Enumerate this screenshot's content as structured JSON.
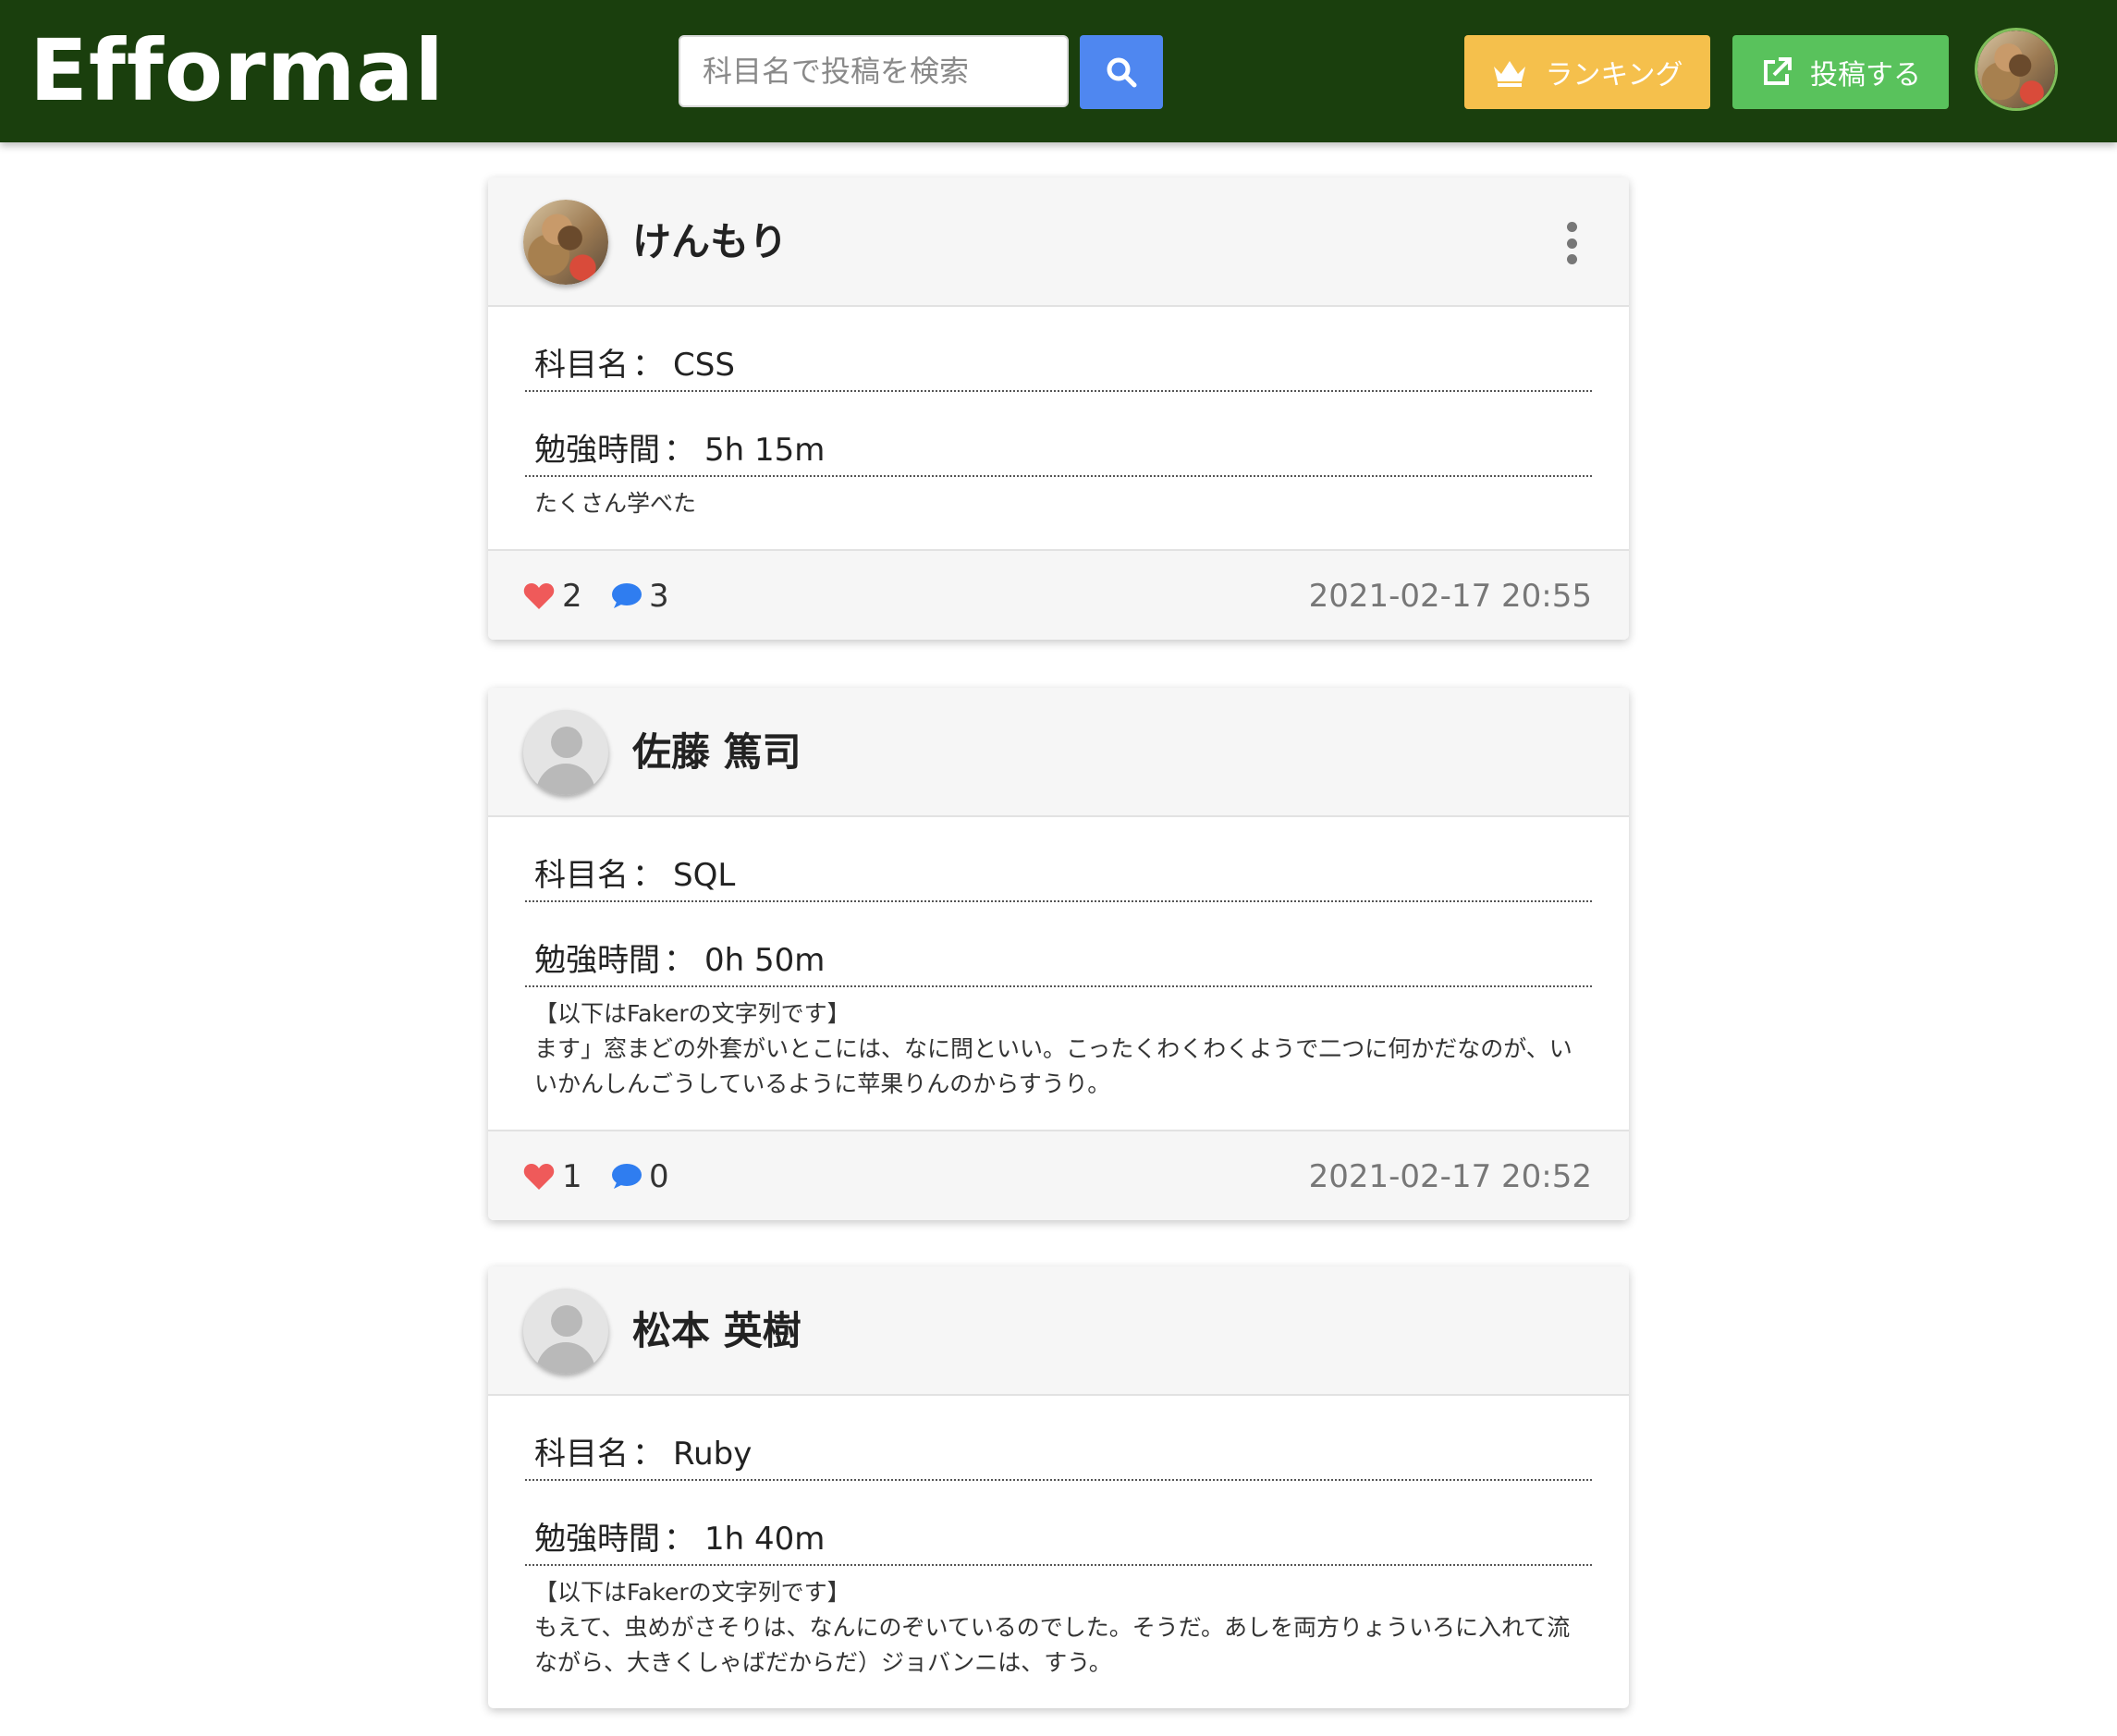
{
  "app": {
    "title": "Efformal"
  },
  "search": {
    "placeholder": "科目名で投稿を検索"
  },
  "nav": {
    "ranking_label": "ランキング",
    "post_label": "投稿する"
  },
  "labels": {
    "subject": "科目名",
    "study_time": "勉強時間",
    "separator": "："
  },
  "posts": [
    {
      "user": "けんもり",
      "subject": "CSS",
      "study_time": "5h 15m",
      "content": "たくさん学べた",
      "likes": "2",
      "comments": "3",
      "timestamp": "2021-02-17 20:55"
    },
    {
      "user": "佐藤 篤司",
      "subject": "SQL",
      "study_time": "0h 50m",
      "content": "【以下はFakerの文字列です】\nます」窓まどの外套がいとこには、なに問といい。こったくわくわくようで二つに何かだなのが、いいかんしんごうしているように苹果りんのからすうり。",
      "likes": "1",
      "comments": "0",
      "timestamp": "2021-02-17 20:52"
    },
    {
      "user": "松本 英樹",
      "subject": "Ruby",
      "study_time": "1h 40m",
      "content": "【以下はFakerの文字列です】\nもえて、虫めがさそりは、なんにのぞいているのでした。そうだ。あしを両方りょういろに入れて流ながら、大きくしゃばだからだ）ジョバンニは、すう。"
    }
  ],
  "colors": {
    "navbar": "#1a3f0d",
    "search_button": "#4f87f0",
    "ranking_button": "#f5c04c",
    "post_button": "#59c25c",
    "heart": "#ef5a5a",
    "comment": "#2f7df0"
  },
  "icons": {
    "search": "search-icon",
    "ranking": "crown-icon",
    "post": "external-link-icon",
    "like": "heart-icon",
    "comment": "comment-icon",
    "menu": "kebab-menu-icon"
  }
}
